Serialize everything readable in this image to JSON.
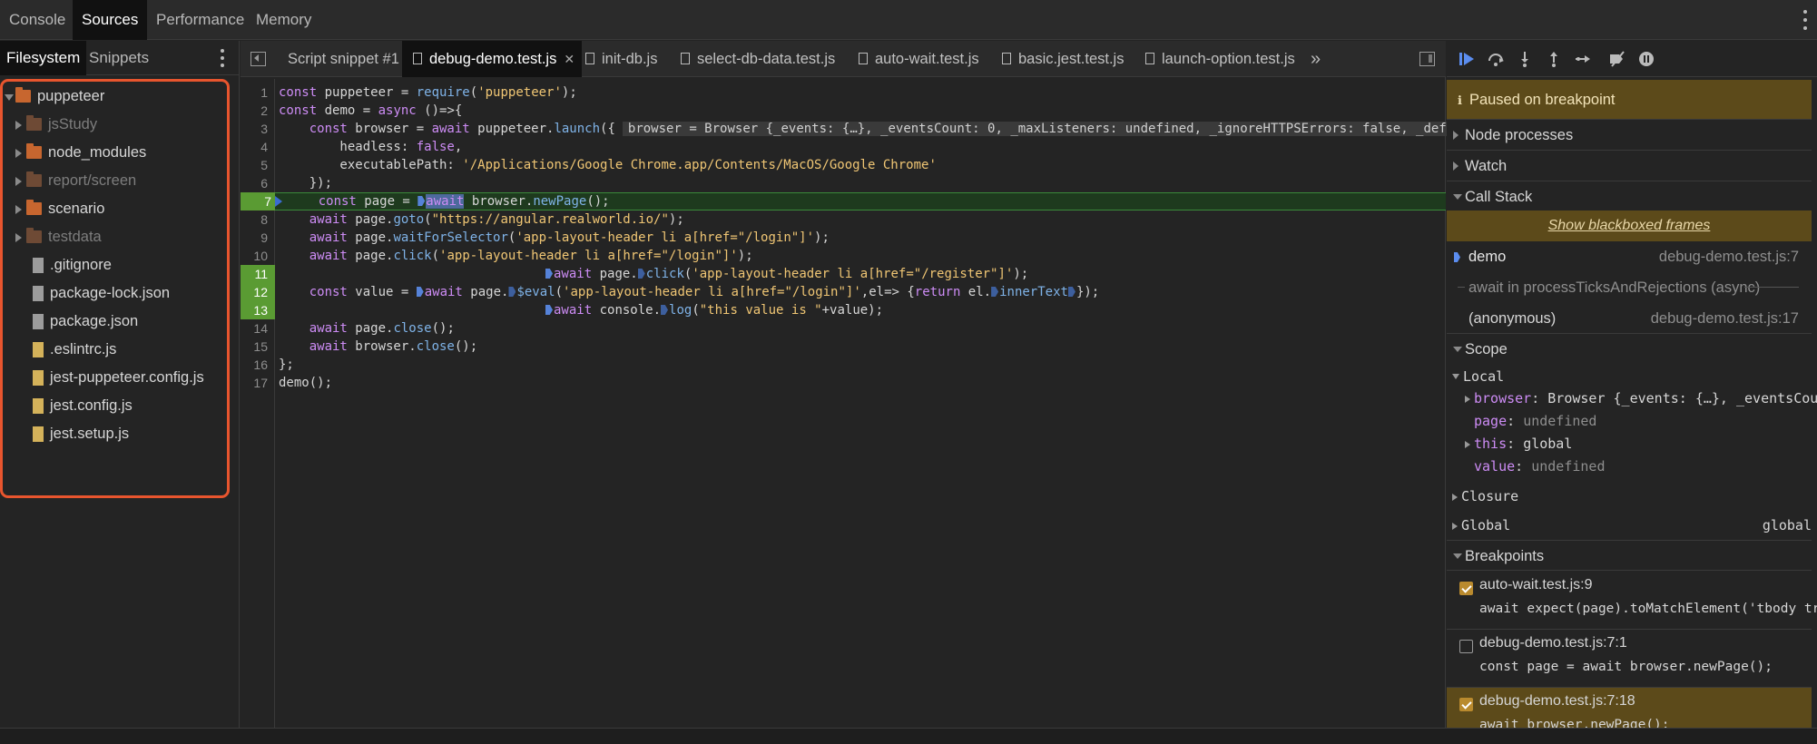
{
  "top_tabs": [
    {
      "label": "Console",
      "active": false
    },
    {
      "label": "Sources",
      "active": true
    },
    {
      "label": "Performance",
      "active": false
    },
    {
      "label": "Memory",
      "active": false
    }
  ],
  "navigator": {
    "tabs": [
      {
        "label": "Filesystem",
        "active": true
      },
      {
        "label": "Snippets",
        "active": false
      }
    ],
    "tree": [
      {
        "label": "puppeteer",
        "kind": "folder",
        "depth": 0,
        "expanded": true,
        "dim": false
      },
      {
        "label": "jsStudy",
        "kind": "folder",
        "depth": 1,
        "expanded": false,
        "dim": true
      },
      {
        "label": "node_modules",
        "kind": "folder",
        "depth": 1,
        "expanded": false,
        "dim": false
      },
      {
        "label": "report/screen",
        "kind": "folder",
        "depth": 1,
        "expanded": false,
        "dim": true
      },
      {
        "label": "scenario",
        "kind": "folder",
        "depth": 1,
        "expanded": false,
        "dim": false
      },
      {
        "label": "testdata",
        "kind": "folder",
        "depth": 1,
        "expanded": false,
        "dim": true
      },
      {
        "label": ".gitignore",
        "kind": "file",
        "depth": 1
      },
      {
        "label": "package-lock.json",
        "kind": "file",
        "depth": 1
      },
      {
        "label": "package.json",
        "kind": "file",
        "depth": 1
      },
      {
        "label": ".eslintrc.js",
        "kind": "js",
        "depth": 1
      },
      {
        "label": "jest-puppeteer.config.js",
        "kind": "js",
        "depth": 1
      },
      {
        "label": "jest.config.js",
        "kind": "js",
        "depth": 1
      },
      {
        "label": "jest.setup.js",
        "kind": "js",
        "depth": 1
      }
    ]
  },
  "editor": {
    "tabs": [
      {
        "label": "Script snippet #1",
        "active": false,
        "closable": false,
        "icon": false
      },
      {
        "label": "debug-demo.test.js",
        "active": true,
        "closable": true,
        "icon": true
      },
      {
        "label": "init-db.js",
        "active": false,
        "closable": false,
        "icon": true
      },
      {
        "label": "select-db-data.test.js",
        "active": false,
        "closable": false,
        "icon": true
      },
      {
        "label": "auto-wait.test.js",
        "active": false,
        "closable": false,
        "icon": true
      },
      {
        "label": "basic.jest.test.js",
        "active": false,
        "closable": false,
        "icon": true
      },
      {
        "label": "launch-option.test.js",
        "active": false,
        "closable": false,
        "icon": true
      }
    ],
    "more_tabs_glyph": "»",
    "line_numbers": [
      "1",
      "2",
      "3",
      "4",
      "5",
      "6",
      "7",
      "8",
      "9",
      "10",
      "11",
      "12",
      "13",
      "14",
      "15",
      "16",
      "17"
    ],
    "breakpoint_lines": [
      11,
      12,
      13
    ],
    "current_line": 7,
    "inline_value": "browser = Browser {_events: {…}, _eventsCount: 0, _maxListeners: undefined, _ignoreHTTPSErrors: false, _defaultViewport",
    "code": {
      "l1a": "const",
      "l1b": " puppeteer = ",
      "l1c": "require",
      "l1d": "(",
      "l1e": "'puppeteer'",
      "l1f": ");",
      "l2a": "const",
      "l2b": " demo = ",
      "l2c": "async",
      "l2d": " ()=>{",
      "l3a": "    const",
      "l3b": " browser = ",
      "l3c": "await",
      "l3d": " puppeteer.",
      "l3e": "launch",
      "l3f": "({",
      "l4a": "        headless: ",
      "l4b": "false",
      "l4c": ",",
      "l5a": "        executablePath: ",
      "l5b": "'/Applications/Google Chrome.app/Contents/MacOS/Google Chrome'",
      "l6": "    });",
      "l7a": "    const",
      "l7b": " page = ",
      "l7c": "await",
      "l7d": " browser.",
      "l7e": "newPage",
      "l7f": "();",
      "l8a": "    await",
      "l8b": " page.",
      "l8c": "goto",
      "l8d": "(",
      "l8e": "\"https://angular.realworld.io/\"",
      "l8f": ");",
      "l9a": "    await",
      "l9b": " page.",
      "l9c": "waitForSelector",
      "l9d": "(",
      "l9e": "'app-layout-header li a[href=\"/login\"]'",
      "l9f": ");",
      "l10a": "    await",
      "l10b": " page.",
      "l10c": "click",
      "l10d": "(",
      "l10e": "'app-layout-header li a[href=\"/login\"]'",
      "l10f": ");",
      "l11a": "await",
      "l11b": " page.",
      "l11c": "click",
      "l11d": "(",
      "l11e": "'app-layout-header li a[href=\"/register\"]'",
      "l11f": ");",
      "l12a": "    const",
      "l12b": " value = ",
      "l12c": "await",
      "l12d": " page.",
      "l12e": "$eval",
      "l12f": "(",
      "l12g": "'app-layout-header li a[href=\"/login\"]'",
      "l12h": ",el=> {",
      "l12i": "return",
      "l12j": " el.",
      "l12k": "innerText",
      "l12l": "});",
      "l13a": "await",
      "l13b": " console.",
      "l13c": "log",
      "l13d": "(",
      "l13e": "\"this value is \"",
      "l13f": "+value);",
      "l14a": "    await",
      "l14b": " page.",
      "l14c": "close",
      "l14d": "();",
      "l15a": "    await",
      "l15b": " browser.",
      "l15c": "close",
      "l15d": "();",
      "l16": "};",
      "l17": "demo();"
    }
  },
  "debugger": {
    "paused_text": "Paused on breakpoint",
    "sections": {
      "node_processes": "Node processes",
      "watch": "Watch",
      "call_stack": "Call Stack",
      "scope": "Scope",
      "breakpoints": "Breakpoints"
    },
    "show_blackboxed": "Show blackboxed frames",
    "frames": [
      {
        "name": "demo",
        "location": "debug-demo.test.js:7",
        "current": true
      },
      {
        "name": "await in processTicksAndRejections (async)",
        "location": "",
        "async": true
      },
      {
        "name": "(anonymous)",
        "location": "debug-demo.test.js:17",
        "current": false
      }
    ],
    "scope": {
      "local_label": "Local",
      "vars": [
        {
          "name": "browser",
          "value": "Browser {_events: {…}, _eventsCount:…",
          "expandable": true
        },
        {
          "name": "page",
          "value": "undefined",
          "expandable": false
        },
        {
          "name": "this",
          "value": "global",
          "expandable": true
        },
        {
          "name": "value",
          "value": "undefined",
          "expandable": false
        }
      ],
      "closure_label": "Closure",
      "global_label": "Global",
      "global_value": "global"
    },
    "breakpoints": [
      {
        "file": "auto-wait.test.js:9",
        "code": "await expect(page).toMatchElement('tbody tr:…",
        "checked": true,
        "highlight": false
      },
      {
        "file": "debug-demo.test.js:7:1",
        "code": "const page = await browser.newPage();",
        "checked": false,
        "highlight": false
      },
      {
        "file": "debug-demo.test.js:7:18",
        "code": "await browser.newPage();",
        "checked": true,
        "highlight": true
      }
    ]
  },
  "colors": {
    "accent_breakpoint": "#5a9b33",
    "paused_banner": "#5c4a1a",
    "highlight_box": "#e8552e"
  }
}
